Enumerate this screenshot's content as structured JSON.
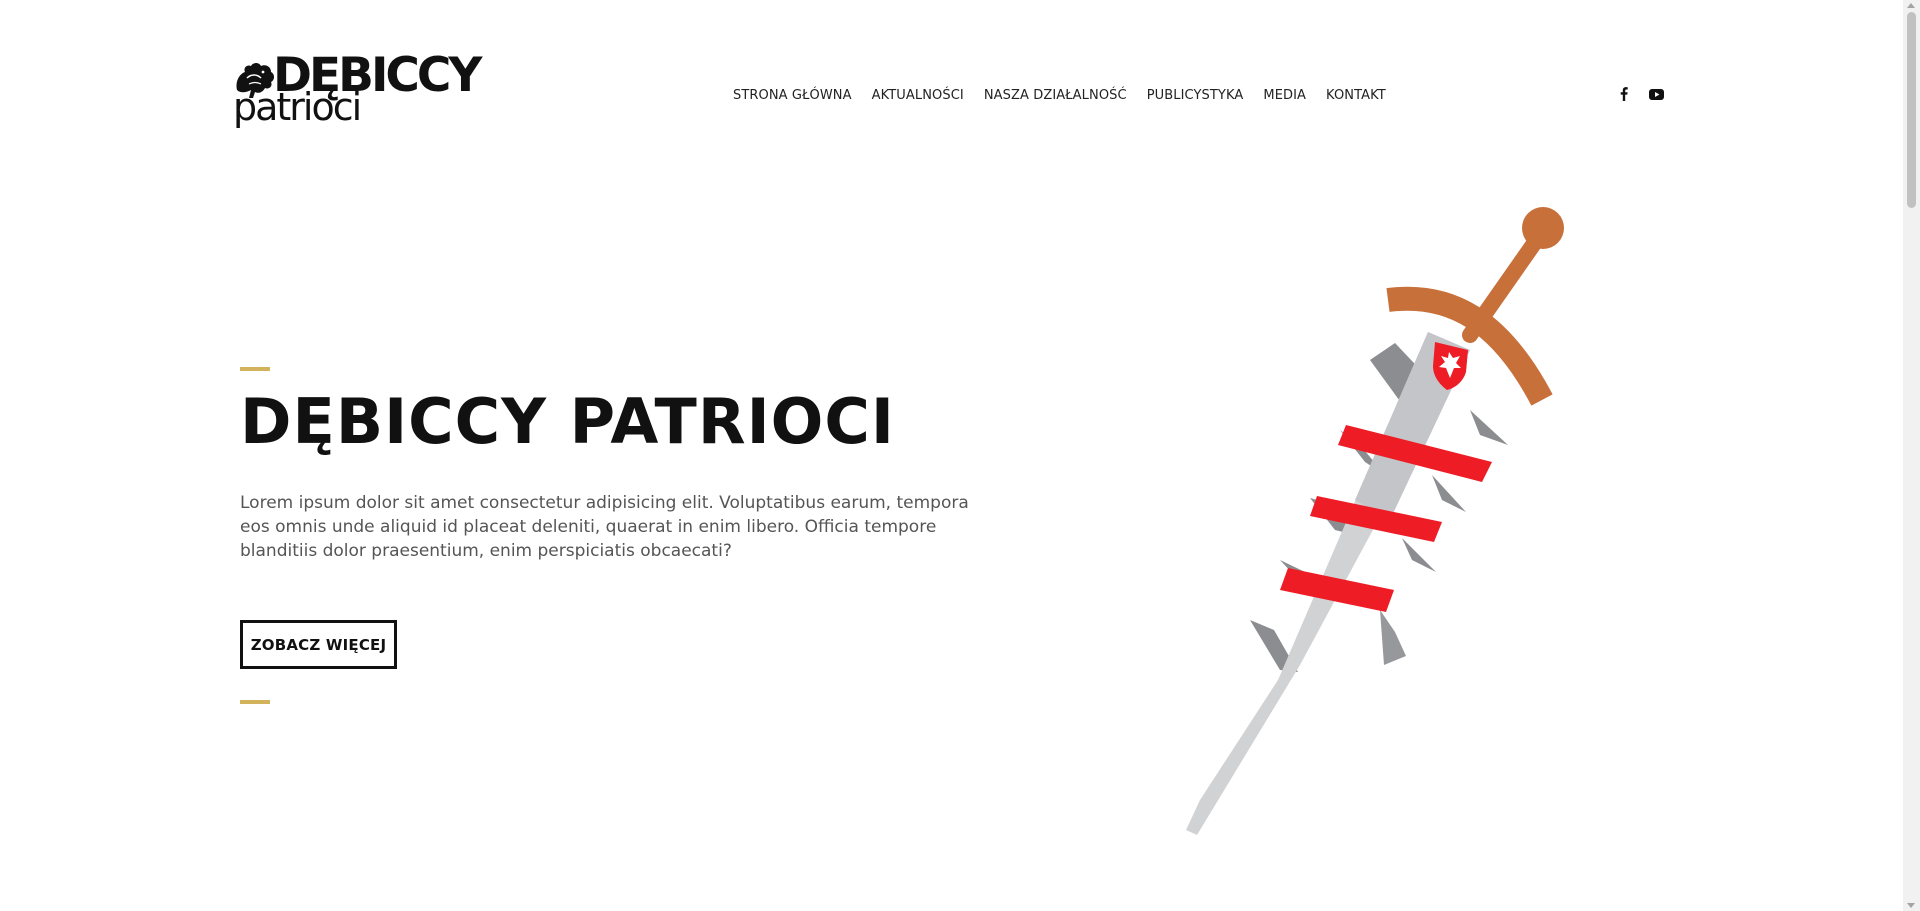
{
  "header": {
    "logo": {
      "line1": "DĘBICCY",
      "line2": "patrioci",
      "icon": "griffin-icon"
    },
    "nav": [
      {
        "label": "STRONA GŁÓWNA"
      },
      {
        "label": "AKTUALNOŚCI"
      },
      {
        "label": "NASZA DZIAŁALNOŚĆ"
      },
      {
        "label": "PUBLICYSTYKA"
      },
      {
        "label": "MEDIA"
      },
      {
        "label": "KONTAKT"
      }
    ],
    "social": [
      {
        "icon": "facebook-icon"
      },
      {
        "icon": "youtube-icon"
      }
    ]
  },
  "hero": {
    "title": "DĘBICCY PATRIOCI",
    "text": "Lorem ipsum dolor sit amet consectetur adipisicing elit. Voluptatibus earum, tempora eos omnis unde aliquid id placeat deleniti, quaerat in enim libero. Officia tempore blanditiis dolor praesentium, enim perspiciatis obcaecati?",
    "cta_label": "ZOBACZ WIĘCEJ",
    "illustration": "sword-illustration"
  },
  "colors": {
    "accent": "#d2b25a",
    "text": "#111111",
    "sword_red": "#ee1c25",
    "sword_copper": "#c8703a",
    "sword_blade": "#d1d2d4",
    "sword_shadow": "#8c8d90"
  }
}
